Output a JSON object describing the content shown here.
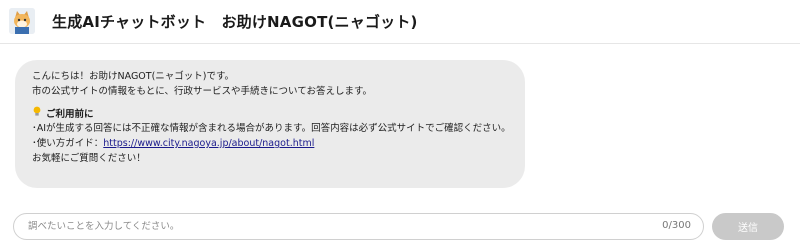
{
  "header": {
    "title": "生成AIチャットボット　お助けNAGOT(ニャゴット)",
    "avatar_icon": "cat-mascot-icon"
  },
  "message": {
    "line1": "こんにちは！お助けNAGOT(ニャゴット)です。",
    "line2": "市の公式サイトの情報をもとに、行政サービスや手続きについてお答えします。",
    "usage_icon": "lightbulb-icon",
    "usage_heading": "ご利用前に",
    "bullet1": "･AIが生成する回答には不正確な情報が含まれる場合があります。回答内容は必ず公式サイトでご確認ください。",
    "bullet2_prefix": "･使い方ガイド：",
    "guide_link": "https://www.city.nagoya.jp/about/nagot.html",
    "closing": "お気軽にご質問ください！"
  },
  "composer": {
    "placeholder": "調べたいことを入力してください。",
    "value": "",
    "char_count": "0/300",
    "send_label": "送信"
  },
  "colors": {
    "bubble_background": "#ebebeb",
    "send_button_disabled": "#c9c9c9",
    "link": "#1a1a8c"
  }
}
